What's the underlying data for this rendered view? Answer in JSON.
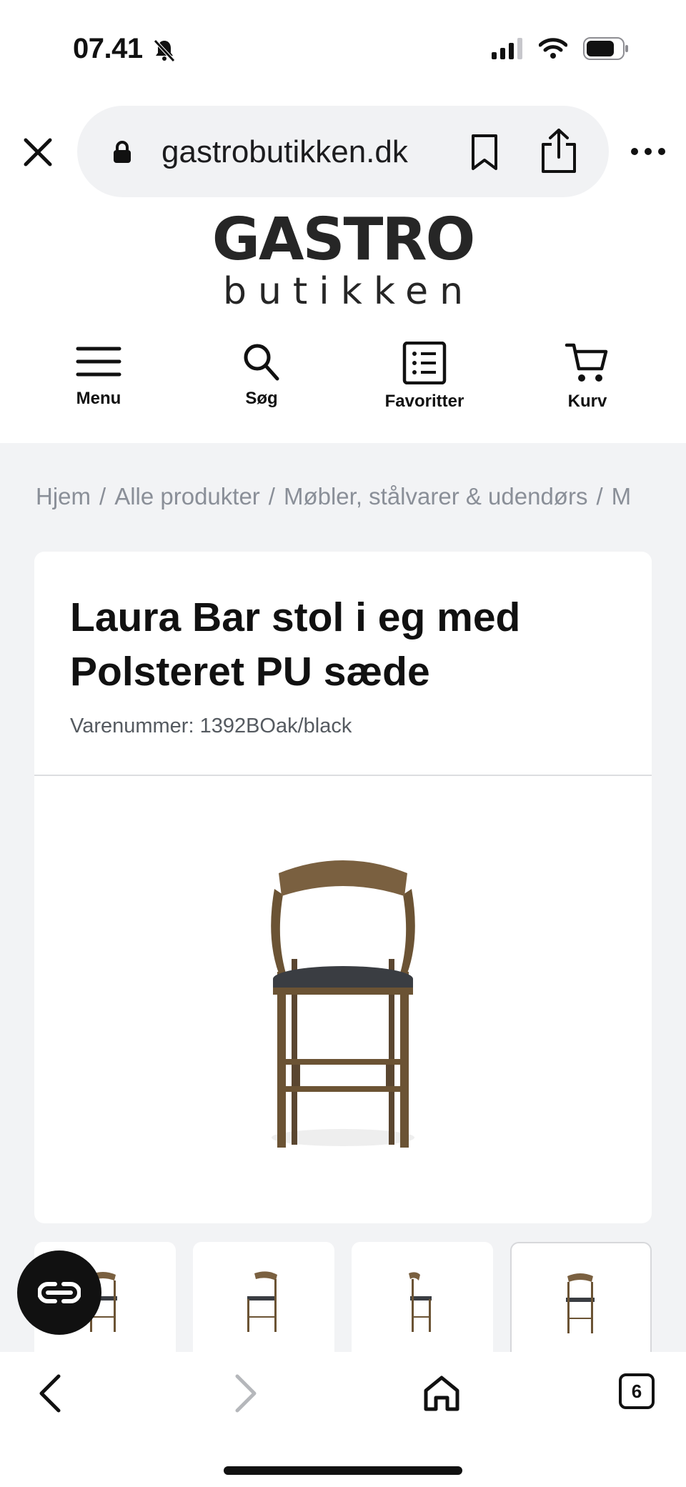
{
  "status_bar": {
    "time": "07.41"
  },
  "browser": {
    "url": "gastrobutikken.dk",
    "tab_count": "6"
  },
  "logo": {
    "top": "GASTRO",
    "bottom": "butikken"
  },
  "nav": {
    "items": [
      {
        "label": "Menu",
        "icon": "menu-icon"
      },
      {
        "label": "Søg",
        "icon": "search-icon"
      },
      {
        "label": "Favoritter",
        "icon": "list-icon"
      },
      {
        "label": "Kurv",
        "icon": "cart-icon"
      }
    ]
  },
  "breadcrumb": {
    "items": [
      "Hjem",
      "Alle produkter",
      "Møbler, stålvarer & udendørs",
      "M"
    ],
    "separator": "/"
  },
  "product": {
    "title": "Laura Bar stol i eg med Polsteret PU sæde",
    "sku": "Varenummer: 1392BOak/black",
    "image_alt": "bar-stool-image",
    "thumbnails": 4,
    "active_thumbnail": 4
  },
  "colors": {
    "background": "#f2f3f5",
    "card": "#ffffff",
    "text": "#111111",
    "muted": "#8a8f98",
    "wood": "#6b5334",
    "seat": "#3a3d42"
  }
}
